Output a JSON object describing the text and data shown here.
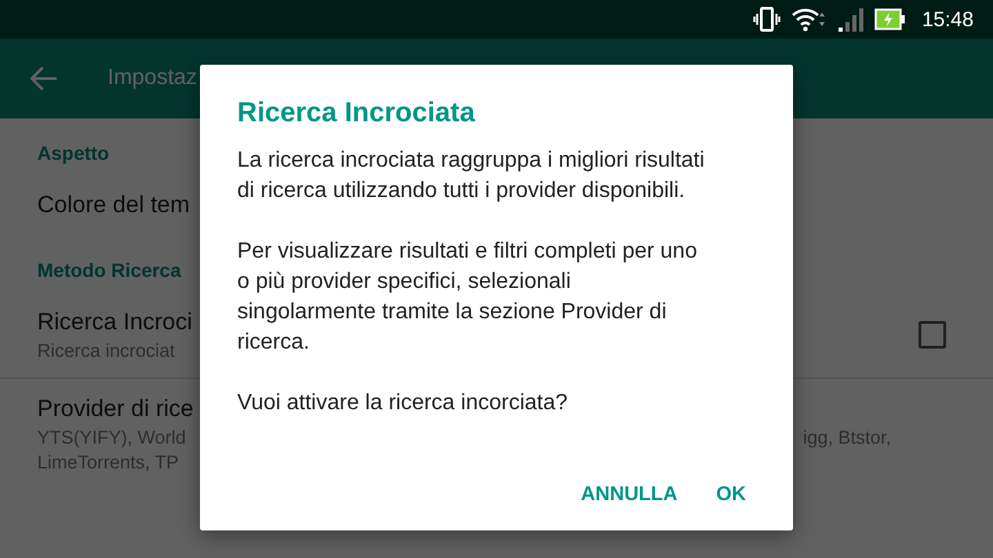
{
  "status_bar": {
    "time": "15:48"
  },
  "app_bar": {
    "title": "Impostaz"
  },
  "settings": [
    {
      "kind": "header",
      "title": "Aspetto"
    },
    {
      "kind": "item",
      "title": "Colore del tem"
    },
    {
      "kind": "header",
      "title": "Metodo Ricerca"
    },
    {
      "kind": "checkbox",
      "title": "Ricerca Incroci",
      "summary": "Ricerca incrociat",
      "checked": false
    },
    {
      "kind": "item",
      "title": "Provider di rice",
      "summary_lines": [
        {
          "left": "YTS(YIFY), World",
          "right": "igg, Btstor,"
        },
        {
          "left": "LimeTorrents, TP"
        }
      ]
    }
  ],
  "dialog": {
    "title": "Ricerca Incrociata",
    "paragraphs": [
      "La ricerca incrociata raggruppa i migliori risultati di ricerca utilizzando tutti i provider disponibili.",
      "Per visualizzare risultati e filtri completi per uno o più provider specifici, selezionali singolarmente tramite la sezione Provider di ricerca.",
      "Vuoi attivare la ricerca incorciata?"
    ],
    "buttons": [
      "ANNULLA",
      "OK"
    ]
  }
}
